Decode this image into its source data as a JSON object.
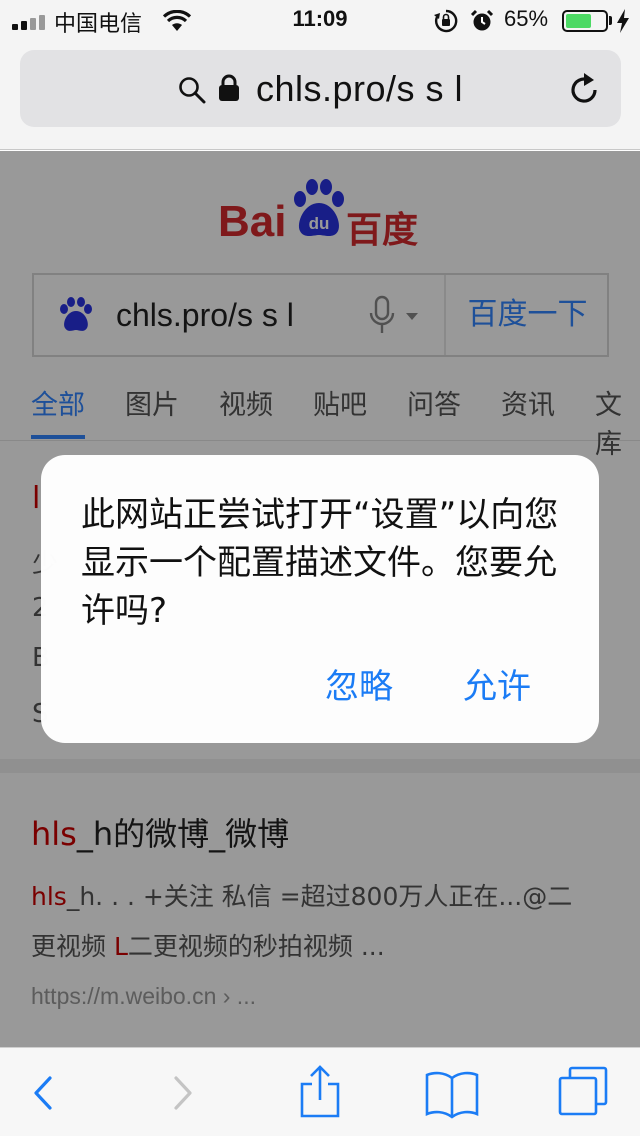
{
  "status_bar": {
    "carrier": "中国电信",
    "time": "11:09",
    "battery_percent": "65%",
    "battery_level": 0.65,
    "icons": [
      "signal-icon",
      "wifi-icon",
      "rotation-lock-icon",
      "alarm-icon",
      "battery-icon",
      "charging-icon"
    ]
  },
  "address_bar": {
    "url": "chls.pro/s s l",
    "icons": [
      "search-icon",
      "lock-icon",
      "reload-icon"
    ]
  },
  "page": {
    "logo": {
      "latin": "Bai",
      "paw_text": "du",
      "chinese": "百度"
    },
    "search": {
      "query": "chls.pro/s s l",
      "button": "百度一下"
    },
    "tabs": [
      {
        "label": "全部",
        "active": true
      },
      {
        "label": "图片",
        "active": false
      },
      {
        "label": "视频",
        "active": false
      },
      {
        "label": "贴吧",
        "active": false
      },
      {
        "label": "问答",
        "active": false
      },
      {
        "label": "资讯",
        "active": false
      },
      {
        "label": "文库",
        "active": false
      }
    ],
    "result1": {
      "title_fragment": "l",
      "line_fragments": [
        "少",
        "2",
        "B",
        "S"
      ]
    },
    "result2": {
      "title_hl": "hls",
      "title_rest": "_h的微博_微博",
      "snippet1_hl": "hls",
      "snippet1_rest": "_h. . . +关注 私信 =超过800万人正在...@二",
      "snippet2_pre": "更视频 ",
      "snippet2_hl": "L",
      "snippet2_rest": "二更视频的秒拍视频 ...",
      "url": "https://m.weibo.cn › ..."
    }
  },
  "alert": {
    "message": "此网站正尝试打开“设置”以向您显示一个配置描述文件。您要允许吗?",
    "ignore_label": "忽略",
    "allow_label": "允许",
    "accent_color": "#1b7cf5"
  },
  "toolbar": {
    "items": [
      "back-icon",
      "forward-icon",
      "share-icon",
      "bookmarks-icon",
      "tabs-icon"
    ]
  }
}
